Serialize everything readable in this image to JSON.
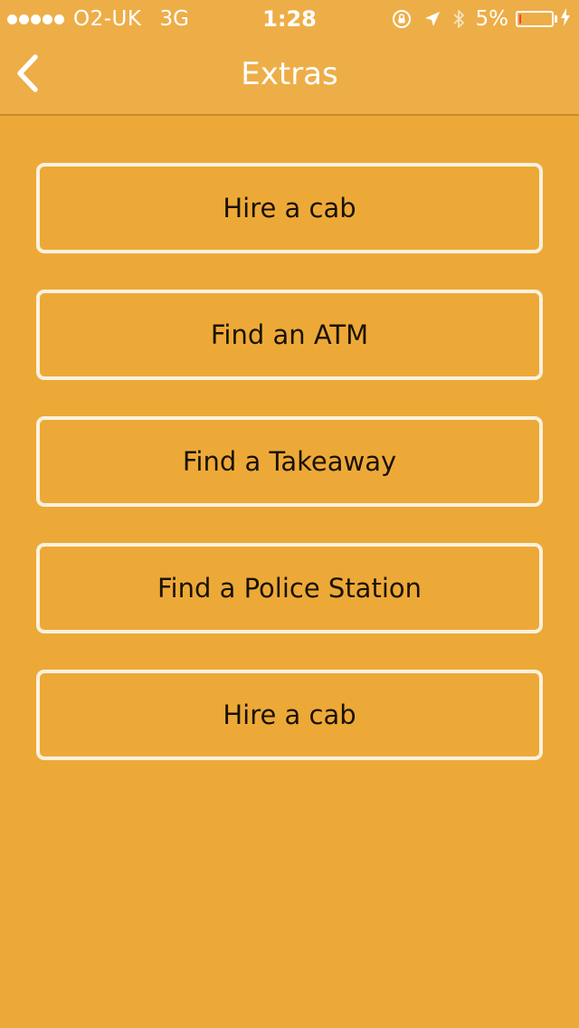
{
  "status_bar": {
    "carrier": "O2-UK",
    "network": "3G",
    "time": "1:28",
    "battery_percent": "5%",
    "battery_level": 0.05,
    "icons": [
      "signal-dots-icon",
      "orientation-lock-icon",
      "location-arrow-icon",
      "bluetooth-icon",
      "battery-icon",
      "charging-bolt-icon"
    ]
  },
  "nav": {
    "title": "Extras",
    "back_icon": "chevron-left-icon"
  },
  "colors": {
    "background": "#EDA938",
    "header": "#EDAE48",
    "button_border": "#FBF1DE",
    "text": "#1A1206",
    "battery_low": "#FF3B30"
  },
  "menu": {
    "items": [
      {
        "label": "Hire a cab"
      },
      {
        "label": "Find an ATM"
      },
      {
        "label": "Find a Takeaway"
      },
      {
        "label": "Find a Police Station"
      },
      {
        "label": "Hire a cab"
      }
    ]
  }
}
